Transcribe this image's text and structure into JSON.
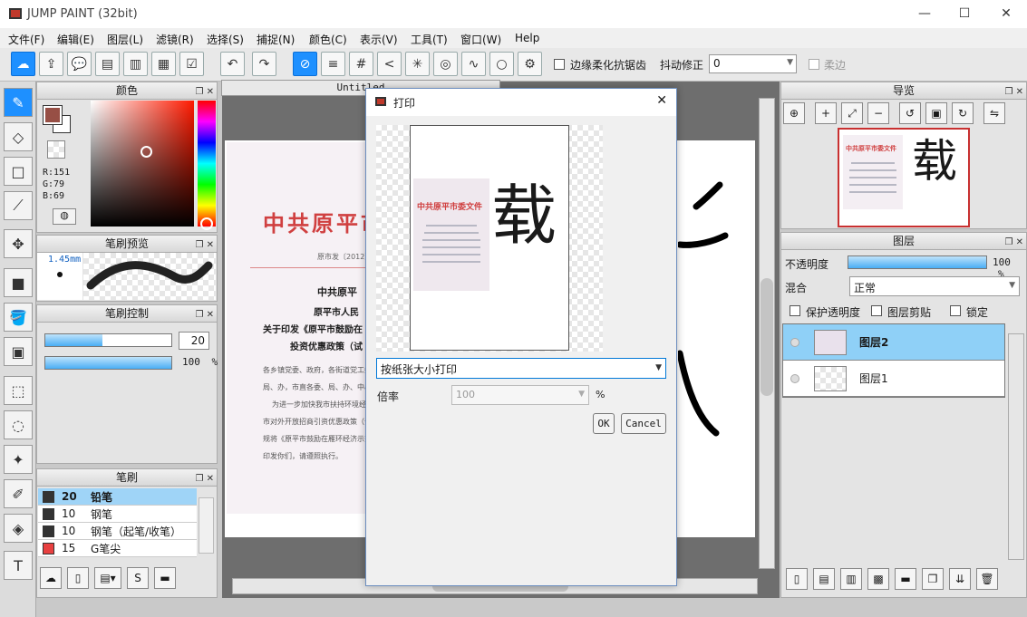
{
  "window": {
    "title": "JUMP PAINT (32bit)",
    "minimize": "—",
    "maximize": "☐",
    "close": "✕"
  },
  "menu": [
    "文件(F)",
    "编辑(E)",
    "图层(L)",
    "滤镜(R)",
    "选择(S)",
    "捕捉(N)",
    "颜色(C)",
    "表示(V)",
    "工具(T)",
    "窗口(W)",
    "Help"
  ],
  "toolbar": {
    "antialias_label": "边缘柔化抗锯齿",
    "stabilizer_label": "抖动修正",
    "stabilizer_value": "0",
    "soft_label": "柔边"
  },
  "color_panel": {
    "title": "颜色",
    "r": "R:151",
    "g": "G:79",
    "b": "B:69",
    "fg": "#974f45"
  },
  "brush_preview": {
    "title": "笔刷预览",
    "size": "1.45mm"
  },
  "brush_control": {
    "title": "笔刷控制",
    "size_value": "20",
    "size_fraction": 0.45,
    "opacity_value": "100",
    "opacity_unit": "%"
  },
  "brushes": {
    "title": "笔刷",
    "items": [
      {
        "size": "20",
        "name": "铅笔",
        "color": "#333333",
        "selected": true
      },
      {
        "size": "10",
        "name": "钢笔",
        "color": "#333333"
      },
      {
        "size": "10",
        "name": "钢笔（起笔/收笔）",
        "color": "#333333"
      },
      {
        "size": "15",
        "name": "G笔尖",
        "color": "#e84040"
      }
    ]
  },
  "canvas": {
    "tab": "Untitled"
  },
  "document": {
    "heading": "中共原平市",
    "docno": "原市发〔2012〕",
    "l1": "中共原平",
    "l2": "原平市人民",
    "l3": "关于印发《原平市鼓励在",
    "l4": "投资优惠政策（试",
    "b1": "各乡镇党委、政府，各街道党工委，",
    "b2": "局、办，市直各委、局、办、中心，",
    "b3": "为进一步加快我市扶持环境经济",
    "b4": "市对外开放招商引资优惠政策（试行",
    "b5": "规将《原平市鼓励在雁环经济示范区",
    "b6": "印发你们，请遵照执行。"
  },
  "dialog": {
    "title": "打印",
    "close": "✕",
    "mode": "按纸张大小打印",
    "scale_label": "倍率",
    "scale_value": "100",
    "scale_unit": "%",
    "ok": "OK",
    "cancel": "Cancel",
    "mini_heading": "中共原平市委文件",
    "char": "载"
  },
  "navigator": {
    "title": "导览",
    "mini_heading": "中共原平市委文件",
    "char": "载"
  },
  "layers": {
    "title": "图层",
    "opacity_label": "不透明度",
    "opacity_value": "100",
    "opacity_unit": "%",
    "opacity_fraction": 1.0,
    "blend_label": "混合",
    "blend_value": "正常",
    "protect_label": "保护透明度",
    "clip_label": "图层剪贴",
    "lock_label": "锁定",
    "items": [
      {
        "name": "图层2",
        "selected": true
      },
      {
        "name": "图层1",
        "selected": false
      }
    ]
  }
}
